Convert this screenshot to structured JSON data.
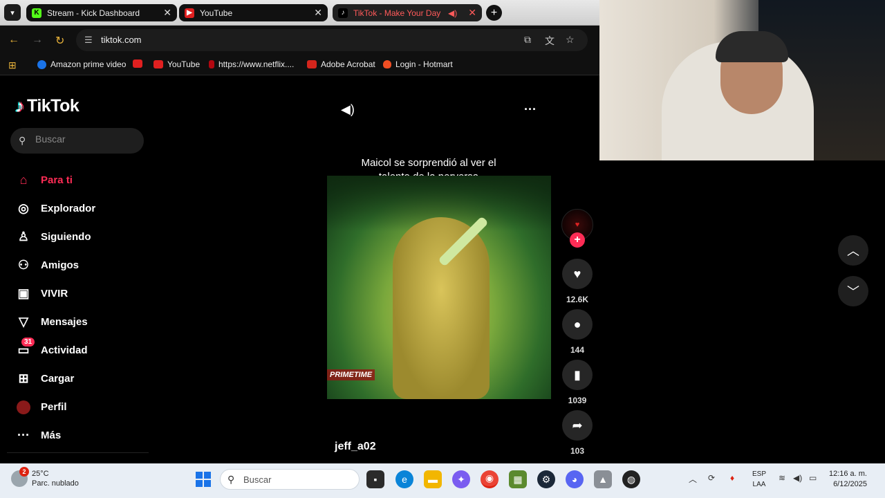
{
  "browser": {
    "tabs": [
      {
        "title": "Stream - Kick Dashboard",
        "favicon": "kick-icon"
      },
      {
        "title": "YouTube",
        "favicon": "youtube-icon"
      },
      {
        "title": "TikTok - Make Your Day",
        "favicon": "tiktok-icon",
        "active": true
      }
    ],
    "url": "tiktok.com",
    "bookmarks": [
      {
        "label": "Amazon prime video"
      },
      {
        "label": "YouTube"
      },
      {
        "label": "https://www.netflix...."
      },
      {
        "label": "Adobe Acrobat"
      },
      {
        "label": "Login - Hotmart"
      }
    ]
  },
  "tiktok": {
    "logo_text": "TikTok",
    "search_placeholder": "Buscar",
    "nav": [
      {
        "label": "Para ti",
        "icon": "home-icon",
        "active": true
      },
      {
        "label": "Explorador",
        "icon": "compass-icon"
      },
      {
        "label": "Siguiendo",
        "icon": "following-icon"
      },
      {
        "label": "Amigos",
        "icon": "friends-icon"
      },
      {
        "label": "VIVIR",
        "icon": "live-tv-icon"
      },
      {
        "label": "Mensajes",
        "icon": "messages-icon"
      },
      {
        "label": "Actividad",
        "icon": "activity-icon",
        "badge": "31"
      },
      {
        "label": "Cargar",
        "icon": "upload-icon"
      },
      {
        "label": "Perfil",
        "icon": "profile-avatar-icon"
      },
      {
        "label": "Más",
        "icon": "more-icon"
      }
    ],
    "video": {
      "caption": "Maicol se sorprendió al ver el talento de la perversa",
      "overlay_tag": "PRIMETIME",
      "author": "jeff_a02",
      "likes": "12.6K",
      "comments": "144",
      "saves": "1039",
      "shares": "103"
    }
  },
  "taskbar": {
    "temperature": "25°C",
    "weather": "Parc. nublado",
    "weather_badge": "2",
    "search_placeholder": "Buscar",
    "lang_top": "ESP",
    "lang_bottom": "LAA",
    "time": "12:16 a. m.",
    "date": "6/12/2025"
  },
  "colors": {
    "accent": "#fe2c55",
    "background": "#000000"
  }
}
